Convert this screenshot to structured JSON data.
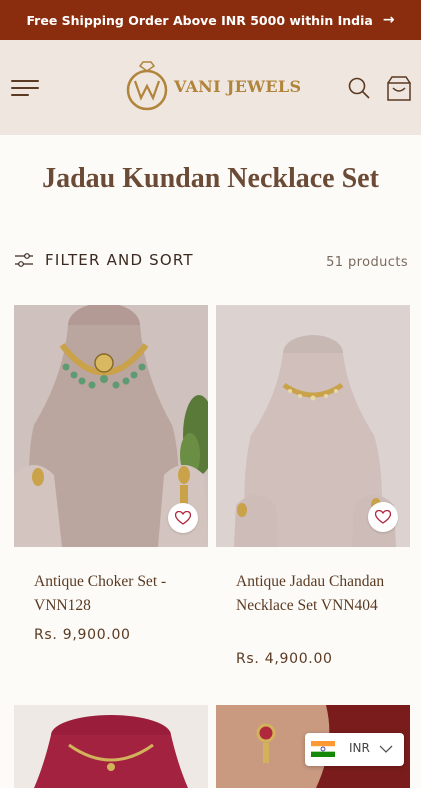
{
  "announcement": {
    "text": "Free Shipping Order Above INR 5000 within India"
  },
  "header": {
    "logo_text": "VANI JEWELS",
    "menu_icon": "hamburger-icon",
    "search_icon": "search-icon",
    "cart_icon": "cart-icon"
  },
  "collection": {
    "title": "Jadau Kundan Necklace Set",
    "filter_label": "FILTER AND SORT",
    "product_count": "51 products"
  },
  "products": [
    {
      "name": "Antique Choker Set - VNN128",
      "price": "Rs. 9,900.00"
    },
    {
      "name": "Antique Jadau Chandan Necklace Set VNN404",
      "price": "Rs. 4,900.00"
    }
  ],
  "currency": {
    "code": "INR",
    "flag": "india-flag-icon"
  },
  "colors": {
    "announcement_bg": "#8a2d0e",
    "header_bg": "#efe6df",
    "brand_gold": "#b0843a",
    "text_brown": "#5a3a22"
  }
}
